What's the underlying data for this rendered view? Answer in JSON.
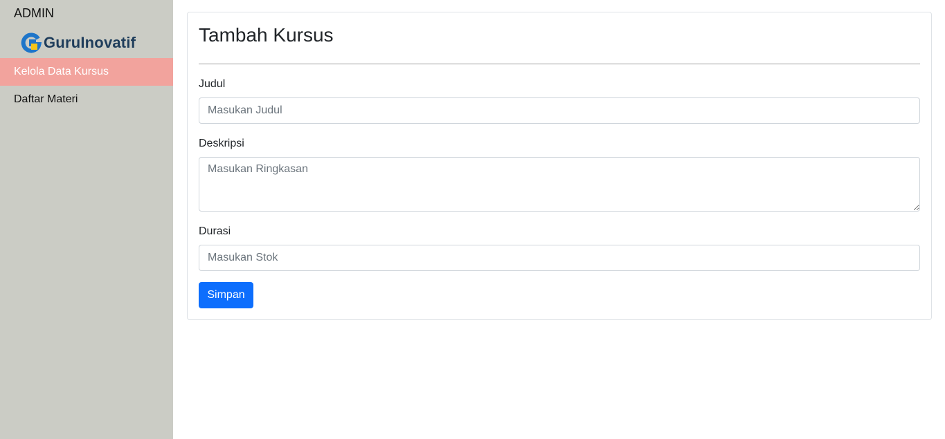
{
  "sidebar": {
    "title": "ADMIN",
    "logo_text": "GuruInovatif",
    "items": [
      {
        "label": "Kelola Data Kursus",
        "active": true
      },
      {
        "label": "Daftar Materi",
        "active": false
      }
    ]
  },
  "form": {
    "title": "Tambah Kursus",
    "fields": {
      "judul": {
        "label": "Judul",
        "placeholder": "Masukan Judul",
        "value": ""
      },
      "deskripsi": {
        "label": "Deskripsi",
        "placeholder": "Masukan Ringkasan",
        "value": ""
      },
      "durasi": {
        "label": "Durasi",
        "placeholder": "Masukan Stok",
        "value": ""
      }
    },
    "submit_label": "Simpan"
  },
  "colors": {
    "sidebar_bg": "#cbccc5",
    "active_item": "#f2a39d",
    "primary": "#0d6efd",
    "logo_text": "#1f3d5b",
    "logo_accent": "#f5c518"
  },
  "icons": {
    "logo": "guruinovatif-logo-icon"
  }
}
